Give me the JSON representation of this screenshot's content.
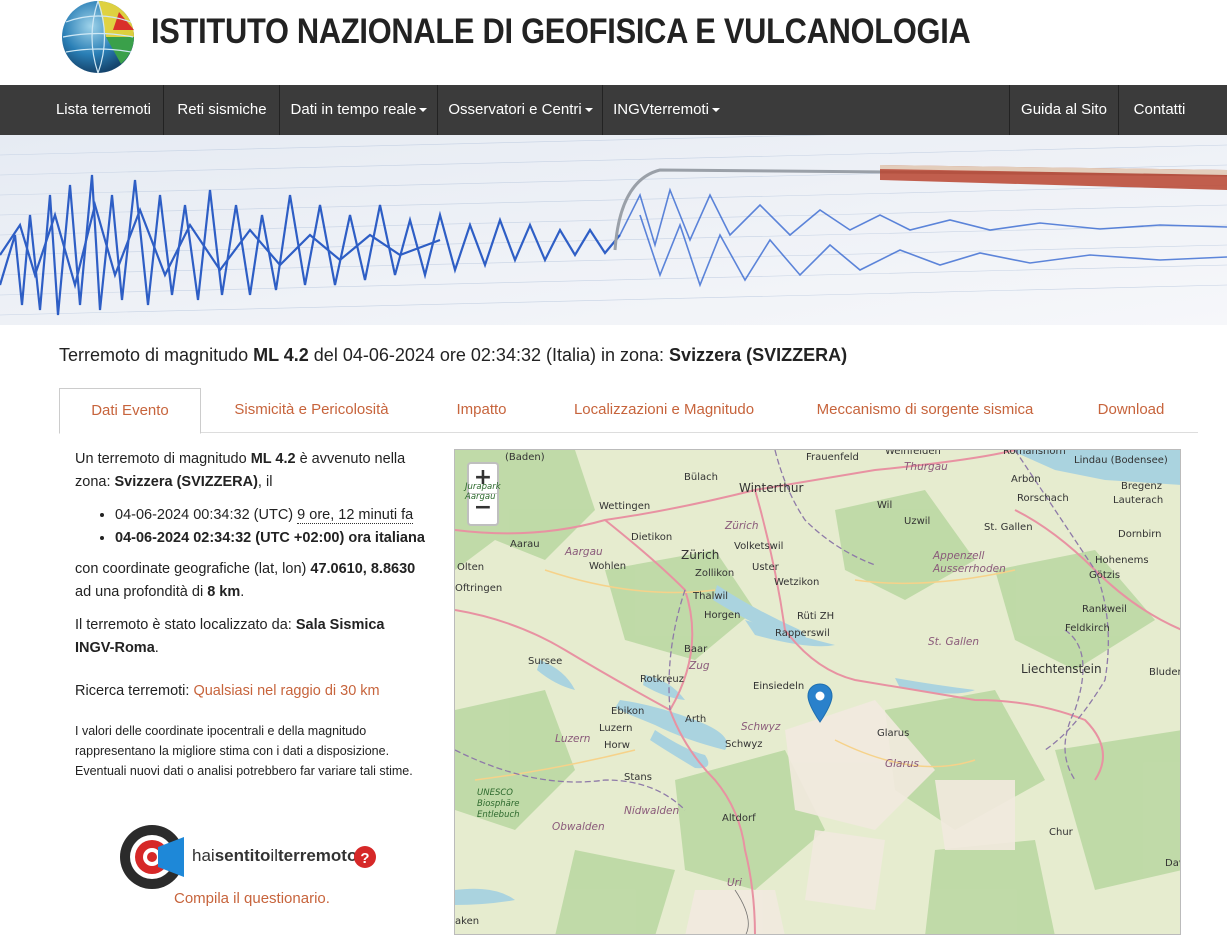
{
  "header": {
    "title": "ISTITUTO NAZIONALE DI GEOFISICA E VULCANOLOGIA"
  },
  "nav": {
    "items": [
      {
        "label": "Lista terremoti"
      },
      {
        "label": "Reti sismiche"
      },
      {
        "label": "Dati in tempo reale"
      },
      {
        "label": "Osservatori e Centri"
      },
      {
        "label": "INGVterremoti"
      },
      {
        "label": "Guida al Sito"
      },
      {
        "label": "Contatti"
      }
    ]
  },
  "headline": {
    "prefix": "Terremoto di magnitudo ",
    "magnitude": "ML 4.2",
    "mid": " del 04-06-2024 ore 02:34:32 (Italia) in zona: ",
    "zone": "Svizzera (SVIZZERA)"
  },
  "tabs": [
    {
      "label": "Dati Evento"
    },
    {
      "label": "Sismicità e Pericolosità"
    },
    {
      "label": "Impatto"
    },
    {
      "label": "Localizzazioni e Magnitudo"
    },
    {
      "label": "Meccanismo di sorgente sismica"
    },
    {
      "label": "Download"
    }
  ],
  "event": {
    "intro_a": "Un terremoto di magnitudo ",
    "magnitude": "ML 4.2",
    "intro_b": " è avvenuto nella zona: ",
    "zone": "Svizzera (SVIZZERA)",
    "intro_c": ", il",
    "utc_time": "04-06-2024 00:34:32 (UTC)",
    "ago": "9 ore, 12 minuti fa",
    "local_time": "04-06-2024 02:34:32 (UTC +02:00) ora italiana",
    "coords_a": "con coordinate geografiche (lat, lon) ",
    "coords": "47.0610, 8.8630",
    "depth_a": "ad una profondità di ",
    "depth": "8 km",
    "located_a": "Il terremoto è stato localizzato da: ",
    "located_by": "Sala Sismica INGV-Roma",
    "search_label": "Ricerca terremoti: ",
    "search_link": "Qualsiasi nel raggio di 30 km",
    "disclaimer": "I valori delle coordinate ipocentrali e della magnitudo rappresentano la migliore stima con i dati a disposizione. Eventuali nuovi dati o analisi potrebbero far variare tali stime.",
    "hai_a": "hai",
    "hai_b": "sentito",
    "hai_c": "il",
    "hai_d": "terremoto",
    "questionnaire": "Compila il questionario."
  },
  "map": {
    "zoom_in": "+",
    "zoom_out": "−",
    "labels": [
      {
        "text": "(Baden)"
      },
      {
        "text": "Frauenfeld"
      },
      {
        "text": "Weinfelden"
      },
      {
        "text": "Romanshorn"
      },
      {
        "text": "Lindau (Bodensee)"
      },
      {
        "text": "Thurgau"
      },
      {
        "text": "Bülach"
      },
      {
        "text": "Winterthur"
      },
      {
        "text": "Arbon"
      },
      {
        "text": "Bregenz"
      },
      {
        "text": "Rorschach"
      },
      {
        "text": "Lauterach"
      },
      {
        "text": "Wettingen"
      },
      {
        "text": "Wil"
      },
      {
        "text": "Uzwil"
      },
      {
        "text": "St. Gallen"
      },
      {
        "text": "Dornbirn"
      },
      {
        "text": "Dietikon"
      },
      {
        "text": "Zürich"
      },
      {
        "text": "Aarau"
      },
      {
        "text": "Aargau"
      },
      {
        "text": "Zürich"
      },
      {
        "text": "Volketswil"
      },
      {
        "text": "Uster"
      },
      {
        "text": "Appenzell Ausserrhoden"
      },
      {
        "text": "Hohenems"
      },
      {
        "text": "Götzis"
      },
      {
        "text": "Olten"
      },
      {
        "text": "Wohlen"
      },
      {
        "text": "Zollikon"
      },
      {
        "text": "Wetzikon"
      },
      {
        "text": "Oftringen"
      },
      {
        "text": "Thalwil"
      },
      {
        "text": "Rankweil"
      },
      {
        "text": "Horgen"
      },
      {
        "text": "Rüti ZH"
      },
      {
        "text": "Feldkirch"
      },
      {
        "text": "Rapperswil"
      },
      {
        "text": "St. Gallen"
      },
      {
        "text": "Baar"
      },
      {
        "text": "Sursee"
      },
      {
        "text": "Zug"
      },
      {
        "text": "Liechtenstein"
      },
      {
        "text": "Rotkreuz"
      },
      {
        "text": "Einsiedeln"
      },
      {
        "text": "Bluden"
      },
      {
        "text": "Ebikon"
      },
      {
        "text": "Arth"
      },
      {
        "text": "Schwyz"
      },
      {
        "text": "Luzern"
      },
      {
        "text": "Luzern"
      },
      {
        "text": "Glarus"
      },
      {
        "text": "Horw"
      },
      {
        "text": "Schwyz"
      },
      {
        "text": "Glarus"
      },
      {
        "text": "Stans"
      },
      {
        "text": "UNESCO Biosphäre Entlebuch"
      },
      {
        "text": "Nidwalden"
      },
      {
        "text": "Obwalden"
      },
      {
        "text": "Altdorf"
      },
      {
        "text": "Chur"
      },
      {
        "text": "Davos"
      },
      {
        "text": "Uri"
      },
      {
        "text": "aken"
      },
      {
        "text": "Jurapark Aargau"
      }
    ]
  }
}
